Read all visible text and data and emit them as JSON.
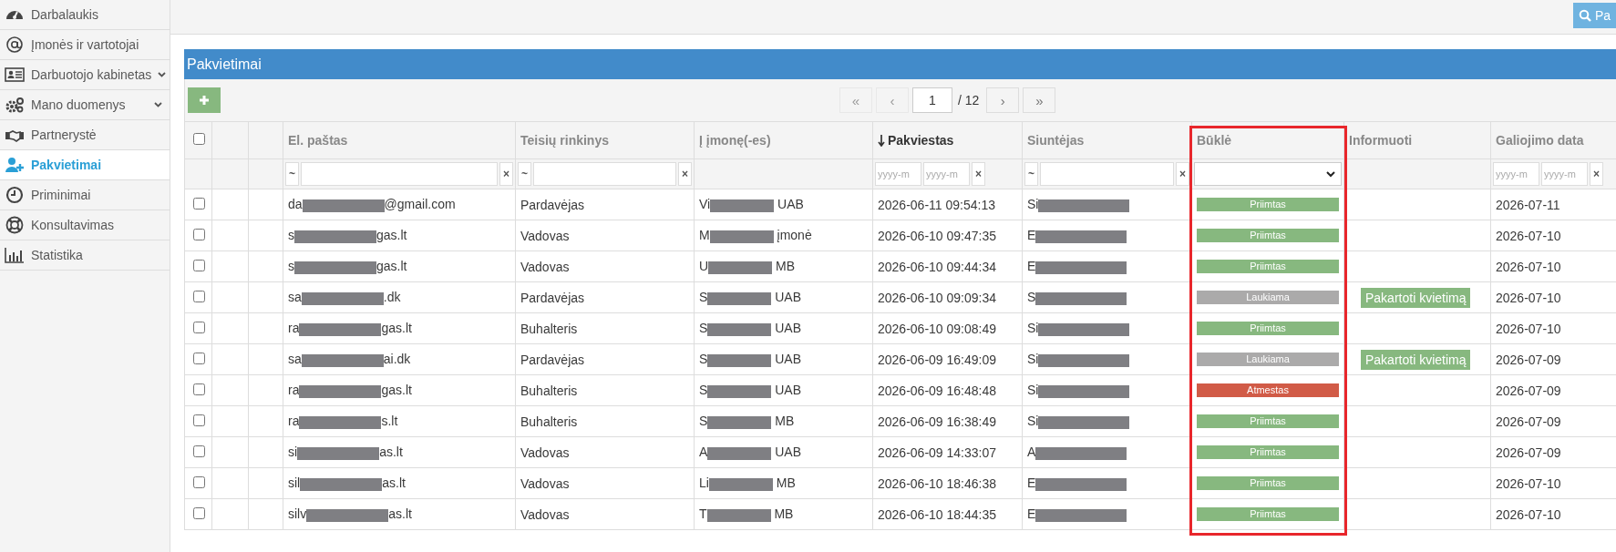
{
  "sidebar": {
    "items": [
      {
        "label": "Darbalaukis",
        "selected": false,
        "has_submenu": false
      },
      {
        "label": "Įmonės ir vartotojai",
        "selected": false,
        "has_submenu": false
      },
      {
        "label": "Darbuotojo kabinetas",
        "selected": false,
        "has_submenu": true
      },
      {
        "label": "Mano duomenys",
        "selected": false,
        "has_submenu": true
      },
      {
        "label": "Partnerystė",
        "selected": false,
        "has_submenu": false
      },
      {
        "label": "Pakvietimai",
        "selected": true,
        "has_submenu": false
      },
      {
        "label": "Priminimai",
        "selected": false,
        "has_submenu": false
      },
      {
        "label": "Konsultavimas",
        "selected": false,
        "has_submenu": false
      },
      {
        "label": "Statistika",
        "selected": false,
        "has_submenu": false
      }
    ]
  },
  "topbar": {
    "search_button": "Pa"
  },
  "panel": {
    "title": "Pakvietimai",
    "pagination": {
      "buttons": [
        {
          "label": "«",
          "disabled": true
        },
        {
          "label": "‹",
          "disabled": true
        },
        {
          "label": "›",
          "disabled": false
        },
        {
          "label": "»",
          "disabled": false
        }
      ],
      "page": "1",
      "total": "/ 12"
    },
    "table": {
      "columns": [
        {
          "kind": "checkbox",
          "checked": false,
          "filter": {
            "kind": "none"
          }
        },
        {
          "kind": "blank",
          "filter": {
            "kind": "none"
          }
        },
        {
          "kind": "blank",
          "filter": {
            "kind": "none"
          }
        },
        {
          "kind": "text",
          "label": "El. paštas",
          "sorted": false,
          "highlighted": false,
          "filter": {
            "kind": "text",
            "prefix": "~",
            "clear": "×"
          }
        },
        {
          "kind": "text",
          "label": "Teisių rinkinys",
          "sorted": false,
          "highlighted": false,
          "filter": {
            "kind": "text",
            "prefix": "~",
            "clear": "×"
          }
        },
        {
          "kind": "text",
          "label": "Į įmonę(-es)",
          "sorted": false,
          "highlighted": false,
          "filter": {
            "kind": "none"
          }
        },
        {
          "kind": "text",
          "label": "Pakviestas",
          "sorted": true,
          "highlighted": false,
          "filter": {
            "kind": "date",
            "placeholders": [
              "yyyy-m",
              "yyyy-m"
            ],
            "clear": "×"
          }
        },
        {
          "kind": "text",
          "label": "Siuntėjas",
          "sorted": false,
          "highlighted": false,
          "filter": {
            "kind": "text",
            "prefix": "~",
            "clear": "×"
          }
        },
        {
          "kind": "text",
          "label": "Būklė",
          "sorted": false,
          "highlighted": true,
          "filter": {
            "kind": "select"
          }
        },
        {
          "kind": "text",
          "label": "Informuoti",
          "sorted": false,
          "highlighted": false,
          "filter": {
            "kind": "none"
          }
        },
        {
          "kind": "text",
          "label": "Galiojimo data",
          "sorted": false,
          "highlighted": false,
          "filter": {
            "kind": "date",
            "placeholders": [
              "yyyy-m",
              "yyyy-m"
            ],
            "clear": "×"
          }
        }
      ],
      "rows": [
        {
          "checked": false,
          "email": {
            "start": "da",
            "end": "@gmail.com"
          },
          "role": "Pardavėjas",
          "company": {
            "start": "Vi",
            "end": "UAB"
          },
          "invited": "2026-06-11 09:54:13",
          "sender": "Si",
          "status": {
            "label": "Priimtas",
            "color": "#87b87f"
          },
          "expiry": "2026-07-11"
        },
        {
          "checked": false,
          "email": {
            "start": "s",
            "end": "gas.lt"
          },
          "role": "Vadovas",
          "company": {
            "start": "M",
            "end": "įmonė"
          },
          "invited": "2026-06-10 09:47:35",
          "sender": "E",
          "status": {
            "label": "Priimtas",
            "color": "#87b87f"
          },
          "expiry": "2026-07-10"
        },
        {
          "checked": false,
          "email": {
            "start": "s",
            "end": "gas.lt"
          },
          "role": "Vadovas",
          "company": {
            "start": "U",
            "end": "MB"
          },
          "invited": "2026-06-10 09:44:34",
          "sender": "E",
          "status": {
            "label": "Priimtas",
            "color": "#87b87f"
          },
          "expiry": "2026-07-10"
        },
        {
          "checked": false,
          "email": {
            "start": "sa",
            "end": ".dk"
          },
          "role": "Pardavėjas",
          "company": {
            "start": "S",
            "end": "UAB"
          },
          "invited": "2026-06-10 09:09:34",
          "sender": "S",
          "status": {
            "label": "Laukiama",
            "color": "#abaaaa"
          },
          "action": "Pakartoti kvietimą",
          "expiry": "2026-07-10"
        },
        {
          "checked": false,
          "email": {
            "start": "ra",
            "end": "gas.lt"
          },
          "role": "Buhalteris",
          "company": {
            "start": "S",
            "end": "UAB"
          },
          "invited": "2026-06-10 09:08:49",
          "sender": "Si",
          "status": {
            "label": "Priimtas",
            "color": "#87b87f"
          },
          "expiry": "2026-07-10"
        },
        {
          "checked": false,
          "email": {
            "start": "sa",
            "end": "ai.dk"
          },
          "role": "Pardavėjas",
          "company": {
            "start": "S",
            "end": "UAB"
          },
          "invited": "2026-06-09 16:49:09",
          "sender": "Si",
          "status": {
            "label": "Laukiama",
            "color": "#abaaaa"
          },
          "action": "Pakartoti kvietimą",
          "expiry": "2026-07-09"
        },
        {
          "checked": false,
          "email": {
            "start": "ra",
            "end": "gas.lt"
          },
          "role": "Buhalteris",
          "company": {
            "start": "S",
            "end": "UAB"
          },
          "invited": "2026-06-09 16:48:48",
          "sender": "Si",
          "status": {
            "label": "Atmestas",
            "color": "#d15b47"
          },
          "expiry": "2026-07-09"
        },
        {
          "checked": false,
          "email": {
            "start": "ra",
            "end": "s.lt"
          },
          "role": "Buhalteris",
          "company": {
            "start": "S",
            "end": "MB"
          },
          "invited": "2026-06-09 16:38:49",
          "sender": "Si",
          "status": {
            "label": "Priimtas",
            "color": "#87b87f"
          },
          "expiry": "2026-07-09"
        },
        {
          "checked": false,
          "email": {
            "start": "si",
            "end": "as.lt"
          },
          "role": "Vadovas",
          "company": {
            "start": "A",
            "end": "UAB"
          },
          "invited": "2026-06-09 14:33:07",
          "sender": "A",
          "status": {
            "label": "Priimtas",
            "color": "#87b87f"
          },
          "expiry": "2026-07-09"
        },
        {
          "checked": false,
          "email": {
            "start": "sil",
            "end": "as.lt"
          },
          "role": "Vadovas",
          "company": {
            "start": "Li",
            "end": "MB"
          },
          "invited": "2026-06-10 18:46:38",
          "sender": "E",
          "status": {
            "label": "Priimtas",
            "color": "#87b87f"
          },
          "expiry": "2026-07-10"
        },
        {
          "checked": false,
          "email": {
            "start": "silv",
            "end": "as.lt"
          },
          "role": "Vadovas",
          "company": {
            "start": "T",
            "end": "MB"
          },
          "invited": "2026-06-10 18:44:35",
          "sender": "E",
          "status": {
            "label": "Priimtas",
            "color": "#87b87f"
          },
          "expiry": "2026-07-10"
        }
      ]
    }
  }
}
